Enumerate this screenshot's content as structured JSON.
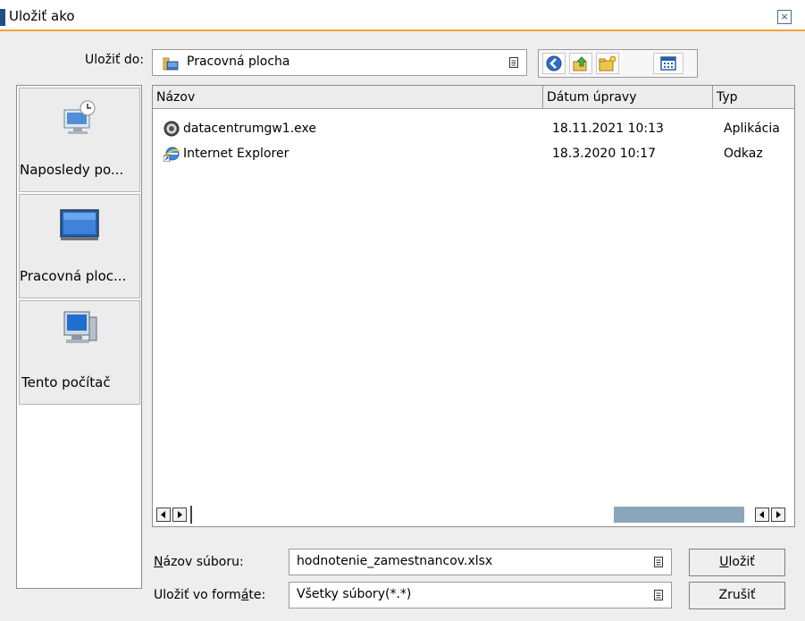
{
  "window": {
    "title": "Uložiť ako"
  },
  "save_in": {
    "label": "Uložiť do:",
    "value": "Pracovná plocha"
  },
  "places": [
    {
      "label": "Naposledy po..."
    },
    {
      "label": "Pracovná ploc..."
    },
    {
      "label": "Tento počítač"
    }
  ],
  "columns": {
    "name": "Názov",
    "date": "Dátum úpravy",
    "type": "Typ"
  },
  "files": [
    {
      "name": "datacentrumgw1.exe",
      "date": "18.11.2021 10:13",
      "type": "Aplikácia",
      "icon": "exe-icon"
    },
    {
      "name": "Internet Explorer",
      "date": "18.3.2020 10:17",
      "type": "Odkaz",
      "icon": "ie-shortcut-icon"
    }
  ],
  "filename": {
    "label_underlined": "N",
    "label_rest": "ázov súboru:",
    "value": "hodnotenie_zamestnancov.xlsx"
  },
  "filetype": {
    "label_pre": "Uložiť vo form",
    "label_underlined": "á",
    "label_post": "te:",
    "value": "Všetky súbory(*.*)"
  },
  "buttons": {
    "save_underlined": "U",
    "save_rest": "ložiť",
    "cancel": "Zrušiť"
  },
  "colors": {
    "accent": "#1e4f86",
    "title_underline": "#f0a63a",
    "scroll_thumb": "#8ba6ba"
  }
}
